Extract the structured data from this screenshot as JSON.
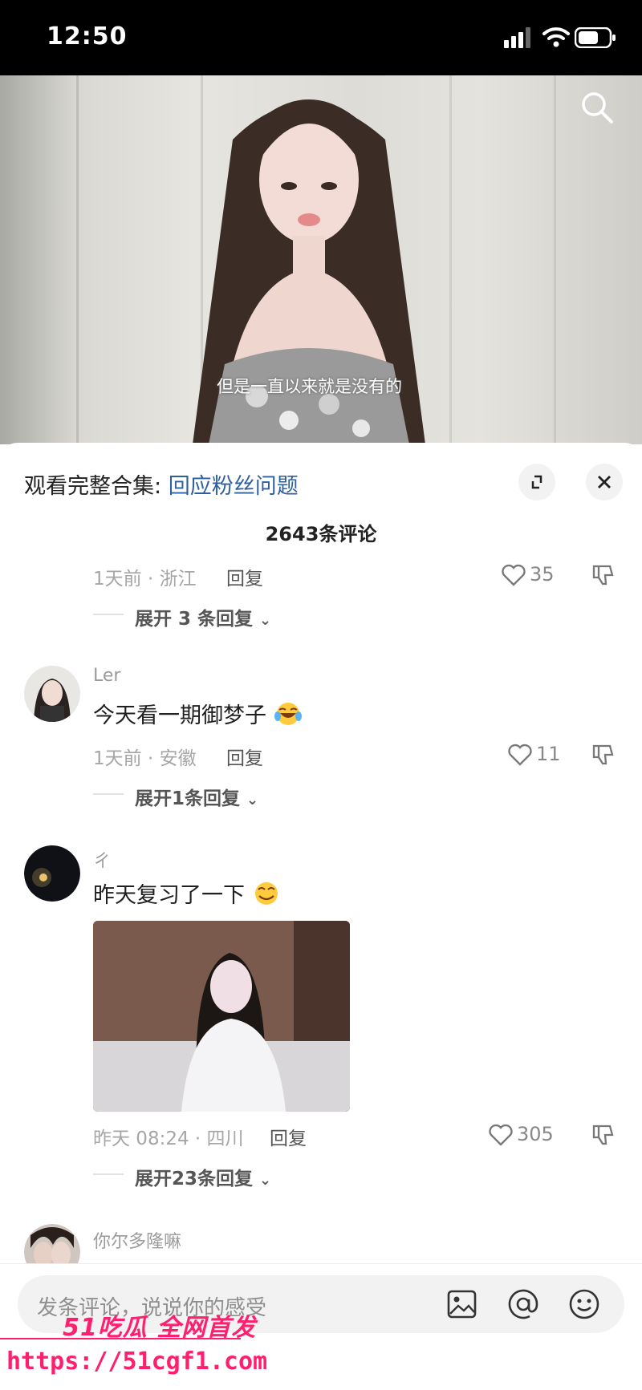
{
  "status_bar": {
    "time": "12:50"
  },
  "video": {
    "subtitle": "但是一直以来就是没有的"
  },
  "sheet": {
    "collection_prefix": "观看完整合集:",
    "collection_link": "回应粉丝问题",
    "comment_count": "2643条评论"
  },
  "comments": [
    {
      "meta": "1天前 · 浙江",
      "reply": "回复",
      "likes": "35",
      "expand": "展开 3 条回复"
    },
    {
      "name": "Ler",
      "text": "今天看一期御梦子",
      "meta": "1天前 · 安徽",
      "reply": "回复",
      "likes": "11",
      "expand": "展开1条回复"
    },
    {
      "name": "ㄔ",
      "text": "昨天复习了一下",
      "meta": "昨天 08:24 · 四川",
      "reply": "回复",
      "likes": "305",
      "expand": "展开23条回复"
    },
    {
      "name": "你尔多隆嘛"
    }
  ],
  "input": {
    "placeholder": "发条评论，说说你的感受"
  },
  "watermark": {
    "brand": "51吃瓜 全网首发",
    "url": "https://51cgf1.com"
  }
}
